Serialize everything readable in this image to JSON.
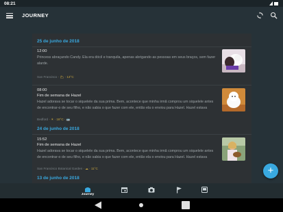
{
  "status_bar": {
    "time": "08:21"
  },
  "app_bar": {
    "title": "JOURNEY"
  },
  "feed": {
    "groups": [
      {
        "date": "25 de junho de 2018",
        "entries": [
          {
            "time": "12:00",
            "title": "",
            "body": "Princess abraçando Candy. Ela era dócil e tranquila, apenas abrigando as pessoas em seus braços, sem fazer alarde.",
            "meta_place": "San Francisco",
            "meta_weather": "· 🌥 · 13°C",
            "thumb_icon": "dog-hug-photo-icon"
          },
          {
            "time": "08:00",
            "title": "Fim de semana de Hazel",
            "body": "Hazel adorava se tocar o siquelele da sua prima. Bem, acontece que minha irmã comprou um siquelele antes de encontrar-o de seu filho, e não sabia o que fazer com ele, então ela o enviou para Hazel. Hazel estava",
            "meta_place": "Bedford",
            "meta_weather": "· ☀ · 18°C · 🚌",
            "thumb_icon": "white-dog-photo-icon"
          }
        ]
      },
      {
        "date": "24 de junho de 2018",
        "entries": [
          {
            "time": "15:52",
            "title": "Fim de semana de Hazel",
            "body": "Hazel adorava se tocar o siquelele da sua prima. Bem, acontece que minha irmã comprou um siquelele antes de encontrar-o de seu filho, e não sabia o que fazer com ele, então ela o enviou para Hazel. Hazel estava",
            "meta_place": "San Francisco Botanical Garden",
            "meta_weather": "· ☁ · 11°C",
            "thumb_icon": "girl-ukulele-photo-icon"
          }
        ]
      },
      {
        "date": "13 de junho de 2018",
        "entries": []
      }
    ]
  },
  "fab": {
    "label": "+"
  },
  "bottom_nav": {
    "items": [
      {
        "id": "journey",
        "label": "Journey",
        "icon": "journey-icon",
        "active": true
      },
      {
        "id": "calendar",
        "label": "",
        "icon": "calendar-icon",
        "active": false
      },
      {
        "id": "photos",
        "label": "",
        "icon": "camera-icon",
        "active": false
      },
      {
        "id": "map",
        "label": "",
        "icon": "flag-icon",
        "active": false
      },
      {
        "id": "today",
        "label": "",
        "icon": "today-icon",
        "active": false
      }
    ]
  },
  "colors": {
    "accent": "#39a9e0",
    "background": "#263238",
    "card": "#2d3134"
  }
}
